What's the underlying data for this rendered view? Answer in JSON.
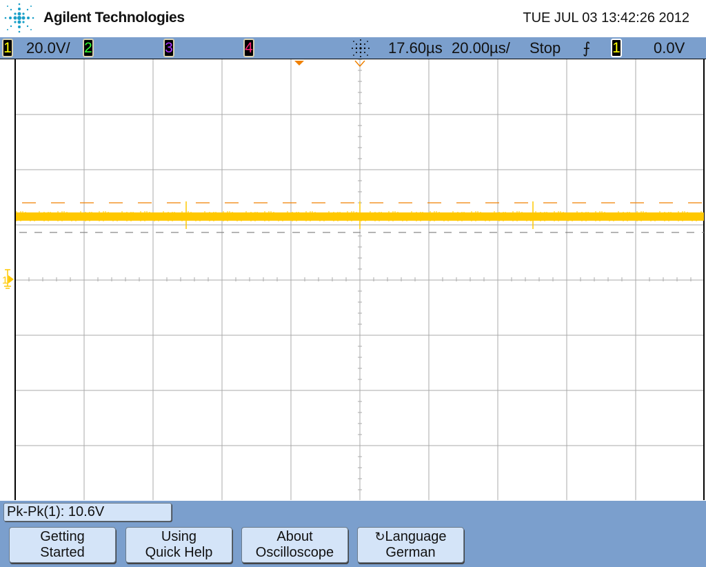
{
  "header": {
    "brand": "Agilent Technologies",
    "datetime": "TUE JUL 03 13:42:26 2012"
  },
  "status": {
    "channels": [
      {
        "num": "1",
        "color": "#ffff00",
        "scale": "20.0V/"
      },
      {
        "num": "2",
        "color": "#33ff33"
      },
      {
        "num": "3",
        "color": "#aa33ff"
      },
      {
        "num": "4",
        "color": "#ff2277"
      }
    ],
    "time_delay": "17.60µs",
    "time_scale": "20.00µs/",
    "run_state": "Stop",
    "trigger_slope": "⨍",
    "trigger_source": "1",
    "trigger_level": "0.0V"
  },
  "trace": {
    "color": "#ffc800",
    "level_div": 1.2
  },
  "measurement": "Pk-Pk(1): 10.6V",
  "softkeys": [
    {
      "line1": "Getting",
      "line2": "Started"
    },
    {
      "line1": "Using",
      "line2": "Quick Help"
    },
    {
      "line1": "About",
      "line2": "Oscilloscope"
    },
    {
      "line1": "Language",
      "line2": "German"
    }
  ]
}
